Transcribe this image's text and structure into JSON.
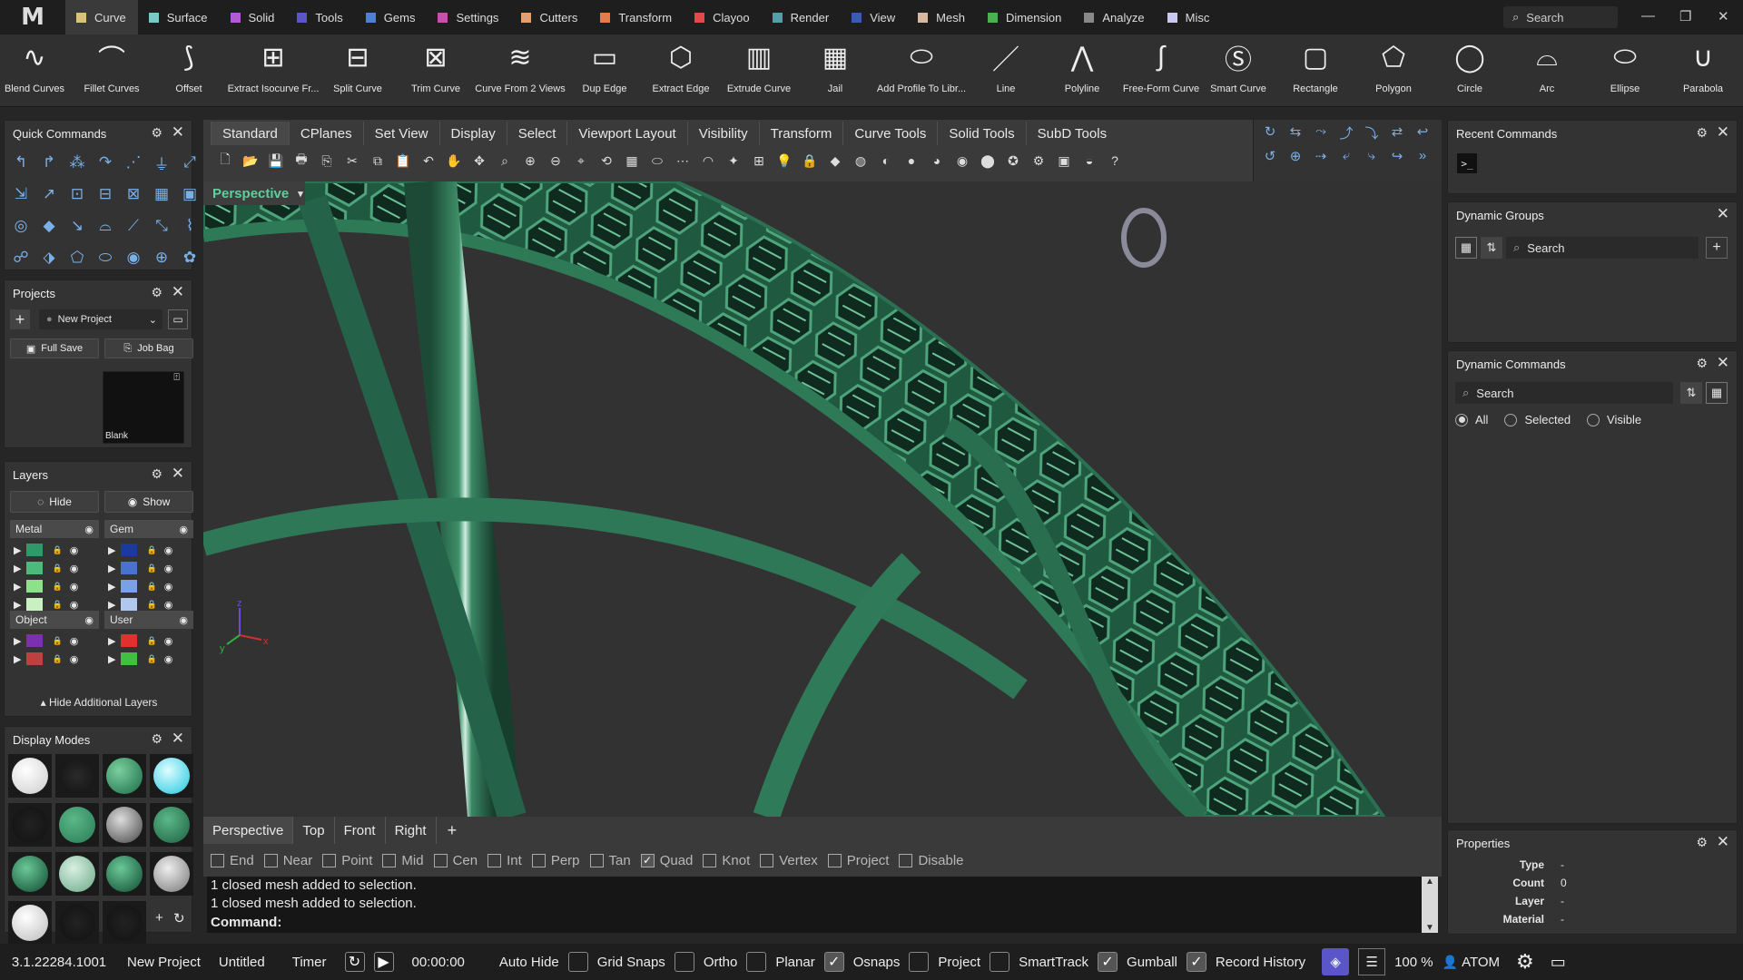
{
  "app": {
    "logo": "M"
  },
  "menu_tabs": [
    {
      "label": "Curve",
      "color": "#d9c27a"
    },
    {
      "label": "Surface",
      "color": "#7ac9c9"
    },
    {
      "label": "Solid",
      "color": "#b05bd1"
    },
    {
      "label": "Tools",
      "color": "#5a55c8"
    },
    {
      "label": "Gems",
      "color": "#4f7fd6"
    },
    {
      "label": "Settings",
      "color": "#c650b0"
    },
    {
      "label": "Cutters",
      "color": "#e0a070"
    },
    {
      "label": "Transform",
      "color": "#e57a4a"
    },
    {
      "label": "Clayoo",
      "color": "#e04a4a"
    },
    {
      "label": "Render",
      "color": "#4fa0a8"
    },
    {
      "label": "View",
      "color": "#3a5cb0"
    },
    {
      "label": "Mesh",
      "color": "#d8b8a0"
    },
    {
      "label": "Dimension",
      "color": "#4cb050"
    },
    {
      "label": "Analyze",
      "color": "#888888"
    },
    {
      "label": "Misc",
      "color": "#c8c8f0"
    }
  ],
  "top_search": "Search",
  "ribbon": [
    "Blend Curves",
    "Fillet Curves",
    "Offset",
    "Extract Isocurve Fr...",
    "Split Curve",
    "Trim Curve",
    "Curve From 2 Views",
    "Dup Edge",
    "Extract Edge",
    "Extrude Curve",
    "Jail",
    "Add Profile To Libr...",
    "Line",
    "Polyline",
    "Free-Form Curve",
    "Smart Curve",
    "Rectangle",
    "Polygon",
    "Circle",
    "Arc",
    "Ellipse",
    "Parabola"
  ],
  "quick_commands": {
    "title": "Quick Commands"
  },
  "projects": {
    "title": "Projects",
    "select": "New Project",
    "full_save": "Full Save",
    "job_bag": "Job Bag",
    "thumb_label": "Blank"
  },
  "layers": {
    "title": "Layers",
    "hide": "Hide",
    "show": "Show",
    "groups": [
      "Metal",
      "Gem",
      "Object",
      "User"
    ],
    "hide_more": "Hide Additional Layers",
    "metal_colors": [
      "#2e9a6a",
      "#4cba7a",
      "#8fe08a",
      "#c8f0c0"
    ],
    "gem_colors": [
      "#1a3aa0",
      "#4a70d0",
      "#7aa0e8",
      "#b0c8f0"
    ],
    "object_colors": [
      "#7a30b0",
      "#c04040"
    ],
    "user_colors": [
      "#e03030",
      "#40c040"
    ]
  },
  "display_modes": {
    "title": "Display Modes"
  },
  "viewport": {
    "tabs": [
      "Standard",
      "CPlanes",
      "Set View",
      "Display",
      "Select",
      "Viewport Layout",
      "Visibility",
      "Transform",
      "Curve Tools",
      "Solid Tools",
      "SubD Tools"
    ],
    "active_view": "Perspective",
    "bottom_tabs": [
      "Perspective",
      "Top",
      "Front",
      "Right"
    ],
    "axis_x": "x",
    "axis_y": "y",
    "axis_z": "z"
  },
  "osnaps": [
    {
      "label": "End",
      "checked": false
    },
    {
      "label": "Near",
      "checked": false
    },
    {
      "label": "Point",
      "checked": false
    },
    {
      "label": "Mid",
      "checked": false
    },
    {
      "label": "Cen",
      "checked": false
    },
    {
      "label": "Int",
      "checked": false
    },
    {
      "label": "Perp",
      "checked": false
    },
    {
      "label": "Tan",
      "checked": false
    },
    {
      "label": "Quad",
      "checked": true
    },
    {
      "label": "Knot",
      "checked": false
    },
    {
      "label": "Vertex",
      "checked": false
    },
    {
      "label": "Project",
      "checked": false
    },
    {
      "label": "Disable",
      "checked": false
    }
  ],
  "command": {
    "history": [
      "1 closed mesh added to selection.",
      "1 closed mesh added to selection."
    ],
    "prompt": "Command:"
  },
  "recent_commands": {
    "title": "Recent Commands"
  },
  "dynamic_groups": {
    "title": "Dynamic Groups",
    "search": "Search"
  },
  "dynamic_commands": {
    "title": "Dynamic Commands",
    "search": "Search",
    "filters": [
      "All",
      "Selected",
      "Visible"
    ]
  },
  "properties": {
    "title": "Properties",
    "rows": [
      {
        "k": "Type",
        "v": "-"
      },
      {
        "k": "Count",
        "v": "0"
      },
      {
        "k": "Layer",
        "v": "-"
      },
      {
        "k": "Material",
        "v": "-"
      }
    ]
  },
  "status": {
    "version": "3.1.22284.1001",
    "project": "New Project",
    "file": "Untitled",
    "timer_label": "Timer",
    "timer": "00:00:00",
    "auto_hide": "Auto Hide",
    "grid_snaps": "Grid Snaps",
    "ortho": "Ortho",
    "planar": "Planar",
    "osnaps": "Osnaps",
    "project_toggle": "Project",
    "smarttrack": "SmartTrack",
    "gumball": "Gumball",
    "record_history": "Record History",
    "zoom": "100 %",
    "user": "ATOM"
  },
  "colors": {
    "accent": "#5ecf9c",
    "metal": "#2d6e50"
  }
}
